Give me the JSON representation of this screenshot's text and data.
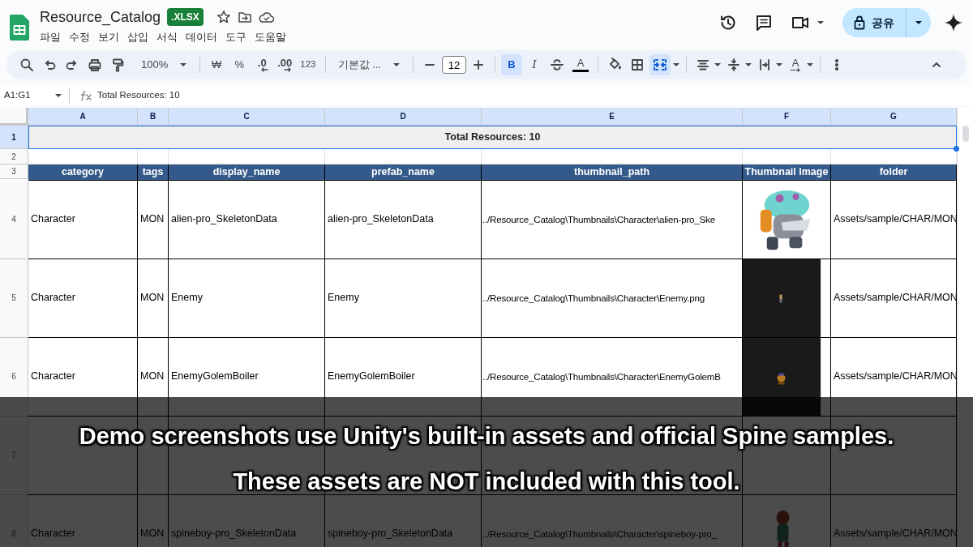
{
  "document": {
    "title": "Resource_Catalog",
    "badge": ".XLSX"
  },
  "menu": [
    "파일",
    "수정",
    "보기",
    "삽입",
    "서식",
    "데이터",
    "도구",
    "도움말"
  ],
  "toolbar": {
    "zoom": "100%",
    "currency": "₩",
    "percent": "%",
    "decimal_decrease": ".0",
    "decimal_increase": ".00",
    "number_format": "123",
    "font": "기본값 ...",
    "font_size": "12",
    "bold": {
      "label": "B",
      "selected": true
    },
    "italic": {
      "label": "I",
      "selected": false
    },
    "text_color": "A",
    "merge_selected": true,
    "rotation": "A"
  },
  "share": {
    "label": "공유"
  },
  "formula_bar": {
    "name_box": "A1:G1",
    "formula": "Total Resources: 10"
  },
  "columns": [
    {
      "label": "A",
      "selected": true
    },
    {
      "label": "B",
      "selected": true
    },
    {
      "label": "C",
      "selected": true
    },
    {
      "label": "D",
      "selected": true
    },
    {
      "label": "E",
      "selected": true
    },
    {
      "label": "F",
      "selected": true
    },
    {
      "label": "G",
      "selected": true
    }
  ],
  "rows": [
    {
      "number": "1",
      "selected": true,
      "kind": "title",
      "text": "Total Resources: 10"
    },
    {
      "number": "2",
      "selected": false,
      "kind": "blank"
    },
    {
      "number": "3",
      "selected": false,
      "kind": "header",
      "cells": [
        "category",
        "tags",
        "display_name",
        "prefab_name",
        "thumbnail_path",
        "Thumbnail Image",
        "folder"
      ]
    },
    {
      "number": "4",
      "selected": false,
      "kind": "data",
      "cells": [
        "Character",
        "MON",
        "alien-pro_SkeletonData",
        "alien-pro_SkeletonData",
        "../Resource_Catalog\\Thumbnails\\Character\\alien-pro_Ske",
        null,
        "Assets/sample/CHAR/MON"
      ],
      "thumbnail": {
        "kind": "picture"
      }
    },
    {
      "number": "5",
      "selected": false,
      "kind": "data",
      "cells": [
        "Character",
        "MON",
        "Enemy",
        "Enemy",
        "../Resource_Catalog\\Thumbnails\\Character\\Enemy.png",
        null,
        "Assets/sample/CHAR/MON"
      ],
      "thumbnail": {
        "kind": "picture"
      }
    },
    {
      "number": "6",
      "selected": false,
      "kind": "data",
      "cells": [
        "Character",
        "MON",
        "EnemyGolemBoiler",
        "EnemyGolemBoiler",
        "../Resource_Catalog\\Thumbnails\\Character\\EnemyGolemB",
        null,
        "Assets/sample/CHAR/MON"
      ],
      "thumbnail": {
        "kind": "picture"
      }
    },
    {
      "number": "7",
      "selected": false,
      "kind": "covered"
    },
    {
      "number": "8",
      "selected": false,
      "kind": "data",
      "cells": [
        "Character",
        "MON",
        "spineboy-pro_SkeletonData",
        "spineboy-pro_SkeletonData",
        "../Resource_Catalog\\Thumbnails\\Character\\spineboy-pro_",
        null,
        "Assets/sample/CHAR/MON"
      ],
      "thumbnail": {
        "kind": "picture"
      }
    }
  ],
  "caption": {
    "lines": [
      "Demo screenshots use Unity's built-in assets and official Spine samples.",
      "These assets are NOT included with this tool."
    ]
  }
}
